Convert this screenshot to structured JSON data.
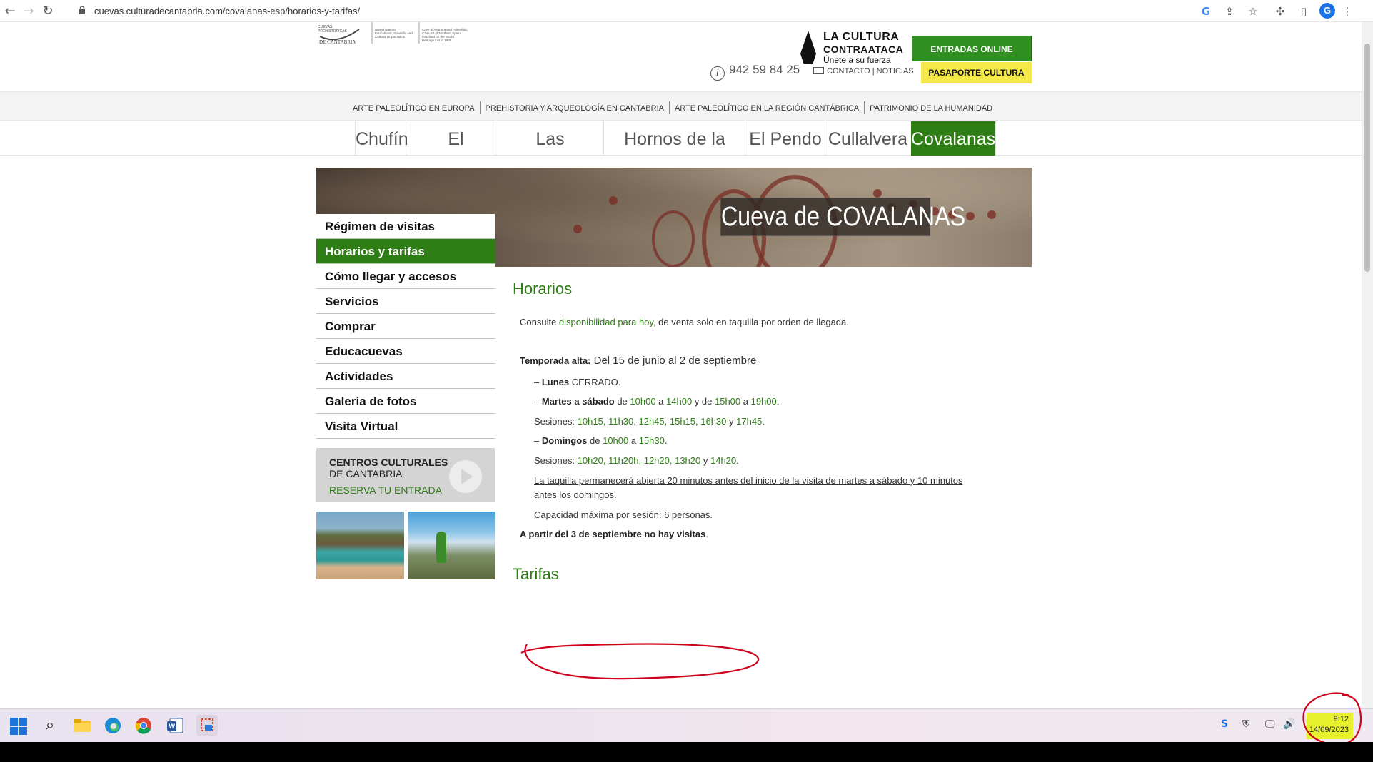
{
  "browser": {
    "url": "cuevas.culturadecantabria.com/covalanas-esp/horarios-y-tarifas/",
    "profile_initial": "G"
  },
  "header": {
    "logo_text_1": "CUEVAS PREHISTÓRICAS",
    "logo_text_2": "DE CANTABRIA",
    "unesco_text": "United Nations Educational, Scientific and Cultural Organization",
    "heritage_text": "Cave of Altamira and Paleolithic Cave Art of Northern Spain",
    "cultura_line1": "LA CULTURA",
    "cultura_line2": "CONTRAATACA",
    "cultura_line3": "Únete a su fuerza",
    "entradas_button": "ENTRADAS ONLINE",
    "phone": "942 59 84 25",
    "contact_links": "CONTACTO | NOTICIAS",
    "pasaporte_button": "PASAPORTE CULTURA"
  },
  "top_links": [
    "ARTE PALEOLÍTICO EN EUROPA",
    "PREHISTORIA Y ARQUEOLOGÍA EN CANTABRIA",
    "ARTE PALEOLÍTICO EN LA REGIÓN CANTÁBRICA",
    "PATRIMONIO DE LA HUMANIDAD"
  ],
  "cave_tabs": [
    "Chufín",
    "El Castillo",
    "Las Monedas",
    "Hornos de la Peña",
    "El Pendo",
    "Cullalvera",
    "Covalanas"
  ],
  "active_tab": "Covalanas",
  "banner_title": "Cueva de COVALANAS",
  "side_menu": [
    "Régimen de visitas",
    "Horarios y tarifas",
    "Cómo llegar y accesos",
    "Servicios",
    "Comprar",
    "Educacuevas",
    "Actividades",
    "Galería de fotos",
    "Visita Virtual"
  ],
  "active_menu": "Horarios y tarifas",
  "centros": {
    "line1": "CENTROS CULTURALES",
    "line2": "DE CANTABRIA",
    "line3": "RESERVA TU ENTRADA"
  },
  "content": {
    "heading": "Horarios",
    "consulte_pre": "Consulte ",
    "consulte_link": "disponibilidad para hoy",
    "consulte_post": ", de venta solo en taquilla por orden de llegada.",
    "temporada_label": "Temporada alta",
    "temporada_colon": ":",
    "temporada_text": " Del 15 de junio al 2 de septiembre",
    "lunes_dash": "– ",
    "lunes_label": "Lunes",
    "lunes_text": " CERRADO.",
    "martes_label": "Martes a sábado",
    "martes_de": " de ",
    "martes_t1": "10h00",
    "martes_a1": " a ",
    "martes_t2": "14h00",
    "martes_yde": " y de ",
    "martes_t3": "15h00",
    "martes_a2": " a ",
    "martes_t4": "19h00",
    "martes_end": ".",
    "sesiones1_label": "Sesiones: ",
    "sesiones1_times": "10h15, 11h30, 12h45, 15h15, 16h30",
    "sesiones1_y": " y ",
    "sesiones1_last": "17h45",
    "sesiones1_end": ".",
    "domingos_label": "Domingos",
    "domingos_de": " de ",
    "domingos_t1": "10h00",
    "domingos_a": " a ",
    "domingos_t2": "15h30",
    "domingos_end": ".",
    "sesiones2_label": "Sesiones: ",
    "sesiones2_times": "10h20, 11h20h, 12h20, 13h20",
    "sesiones2_y": " y ",
    "sesiones2_last": "14h20",
    "sesiones2_end": ".",
    "taquilla_line1": "La taquilla permanecerá abierta 20 minutos antes del inicio de la visita de martes a sábado y 10 minutos",
    "taquilla_line2": "antes los domingos",
    "taquilla_end": ".",
    "capacidad": "Capacidad máxima por sesión: 6 personas.",
    "aviso": "A partir del 3 de septiembre no hay visitas",
    "aviso_end": ".",
    "tarifas_heading": "Tarifas"
  },
  "taskbar": {
    "time": "9:12",
    "date": "14/09/2023"
  },
  "colors": {
    "brand_green": "#2e7d15",
    "button_green": "#2f8f1f",
    "pasaporte_yellow": "#f5e94a",
    "annotation_red": "#d0021b",
    "highlight_yellow": "#e7f12e"
  }
}
